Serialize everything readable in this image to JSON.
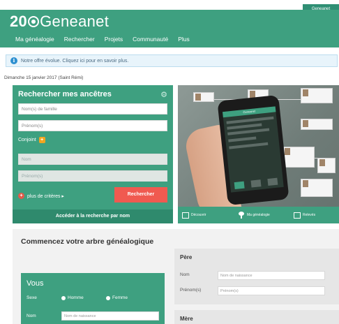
{
  "topbar": {
    "badge": "Geneanet"
  },
  "header": {
    "logo_prefix": "20",
    "logo_name": "Geneanet",
    "nav": [
      "Ma généalogie",
      "Rechercher",
      "Projets",
      "Communauté",
      "Plus"
    ]
  },
  "notice": {
    "icon": "info-icon",
    "text": "Notre offre évolue. Cliquez ici pour en savoir plus."
  },
  "date": "Dimanche 15 janvier 2017 (Saint Rémi)",
  "search": {
    "title": "Rechercher mes ancêtres",
    "surname_placeholder": "Nom(s) de famille",
    "firstname_placeholder": "Prénom(s)",
    "conjoint_label": "Conjoint",
    "conjoint_surname_placeholder": "Nom",
    "conjoint_firstname_placeholder": "Prénom(s)",
    "more_criteria": "plus de critères ▸",
    "search_button": "Rechercher",
    "advanced_link": "Accéder à la recherche par nom"
  },
  "promo": {
    "bar_items": [
      "Découvrir",
      "Ma généalogie",
      "Relevés"
    ],
    "phone_header": "Geneanet"
  },
  "start_tree": {
    "title": "Commencez votre arbre généalogique",
    "vous": {
      "title": "Vous",
      "sex_label": "Sexe",
      "male": "Homme",
      "female": "Femme",
      "name_label": "Nom",
      "name_placeholder": "Nom de naissance"
    },
    "pere": {
      "title": "Père",
      "name_label": "Nom",
      "name_placeholder": "Nom de naissance",
      "firstname_label": "Prénom(s)",
      "firstname_placeholder": "Prénom(s)"
    },
    "mere": {
      "title": "Mère"
    }
  }
}
